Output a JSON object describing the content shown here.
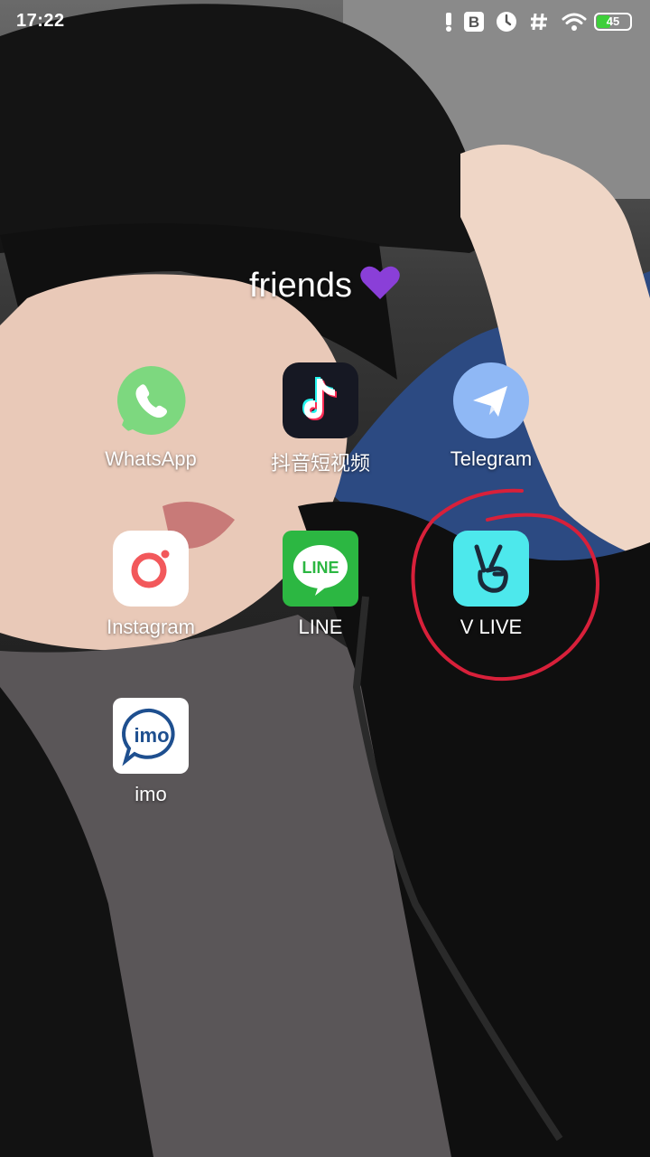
{
  "status_bar": {
    "time": "17:22",
    "notification_icons": [
      "alert-icon",
      "b-letter-icon",
      "clock-icon",
      "hash-icon",
      "wifi-icon"
    ],
    "battery_level": "45",
    "battery_percent": 45,
    "battery_color": "#3ecf3a"
  },
  "folder": {
    "title": "friends",
    "emoji": "purple-heart-icon",
    "apps": [
      {
        "label": "WhatsApp",
        "icon": "whatsapp-icon",
        "color": "#7dd87f"
      },
      {
        "label": "抖音短视频",
        "icon": "tiktok-icon",
        "color": "#161823"
      },
      {
        "label": "Telegram",
        "icon": "telegram-icon",
        "color": "#8fb8f5"
      },
      {
        "label": "Instagram",
        "icon": "instagram-icon",
        "color": "#ffffff"
      },
      {
        "label": "LINE",
        "icon": "line-icon",
        "color": "#2cb742"
      },
      {
        "label": "V LIVE",
        "icon": "vlive-icon",
        "color": "#4de8ec"
      },
      {
        "label": "imo",
        "icon": "imo-icon",
        "color": "#ffffff"
      }
    ]
  },
  "annotation": {
    "type": "red-circle",
    "target": "V LIVE",
    "color": "#d8203a"
  }
}
